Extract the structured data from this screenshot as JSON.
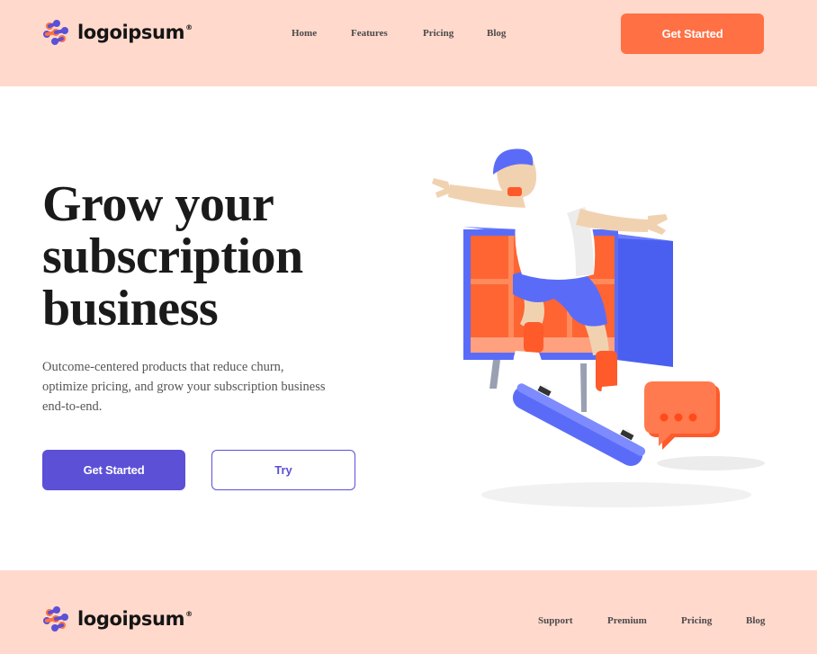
{
  "brand": {
    "name": "logoipsum",
    "mark": "®",
    "colors": {
      "orange": "#ff7044",
      "purple": "#5b50d6",
      "peach": "#ffd9cc"
    }
  },
  "header": {
    "nav": [
      "Home",
      "Features",
      "Pricing",
      "Blog"
    ],
    "cta_label": "Get Started"
  },
  "hero": {
    "title_lines": [
      "Grow your",
      "subscription",
      "business"
    ],
    "description": "Outcome-centered products that reduce churn, optimize pricing, and grow your subscription business end-to-end.",
    "primary_label": "Get Started",
    "secondary_label": "Try"
  },
  "footer": {
    "nav": [
      "Support",
      "Premium",
      "Pricing",
      "Blog"
    ]
  }
}
